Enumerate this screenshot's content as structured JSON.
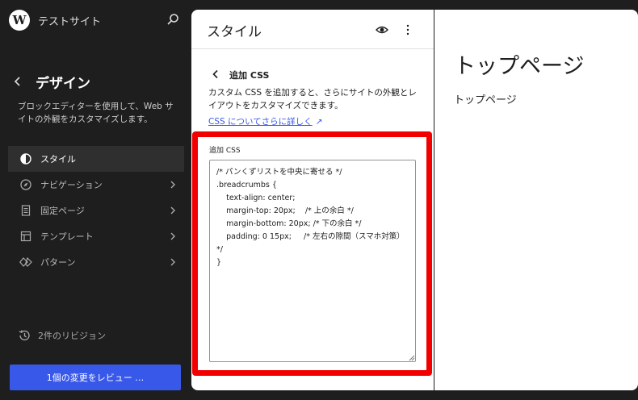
{
  "sidebar": {
    "logo_letter": "W",
    "site_title": "テストサイト",
    "title": "デザイン",
    "description": "ブロックエディターを使用して、Web サイトの外観をカスタマイズします。",
    "items": [
      {
        "label": "スタイル",
        "icon": "half-circle-icon",
        "active": true
      },
      {
        "label": "ナビゲーション",
        "icon": "compass-icon",
        "active": false
      },
      {
        "label": "固定ページ",
        "icon": "page-icon",
        "active": false
      },
      {
        "label": "テンプレート",
        "icon": "layout-icon",
        "active": false
      },
      {
        "label": "パターン",
        "icon": "symbol-icon",
        "active": false
      }
    ],
    "revisions_label": "2件のリビジョン",
    "review_button": "1個の変更をレビュー …"
  },
  "panel": {
    "title": "スタイル",
    "sub_title": "追加 CSS",
    "sub_desc": "カスタム CSS を追加すると、さらにサイトの外観とレイアウトをカスタマイズできます。",
    "link_text": "CSS についてさらに詳しく",
    "link_arrow": "↗",
    "css_label": "追加 CSS",
    "css_value": "/* パンくずリストを中央に寄せる */\n.breadcrumbs {\n    text-align: center;\n    margin-top: 20px;    /* 上の余白 */\n    margin-bottom: 20px; /* 下の余白 */\n    padding: 0 15px;     /* 左右の隙間（スマホ対策） */\n}"
  },
  "canvas": {
    "title": "トップページ",
    "text": "トップページ"
  },
  "colors": {
    "accent": "#3858e9",
    "highlight": "#f20000",
    "sidebar_bg": "#1e1e1e"
  }
}
